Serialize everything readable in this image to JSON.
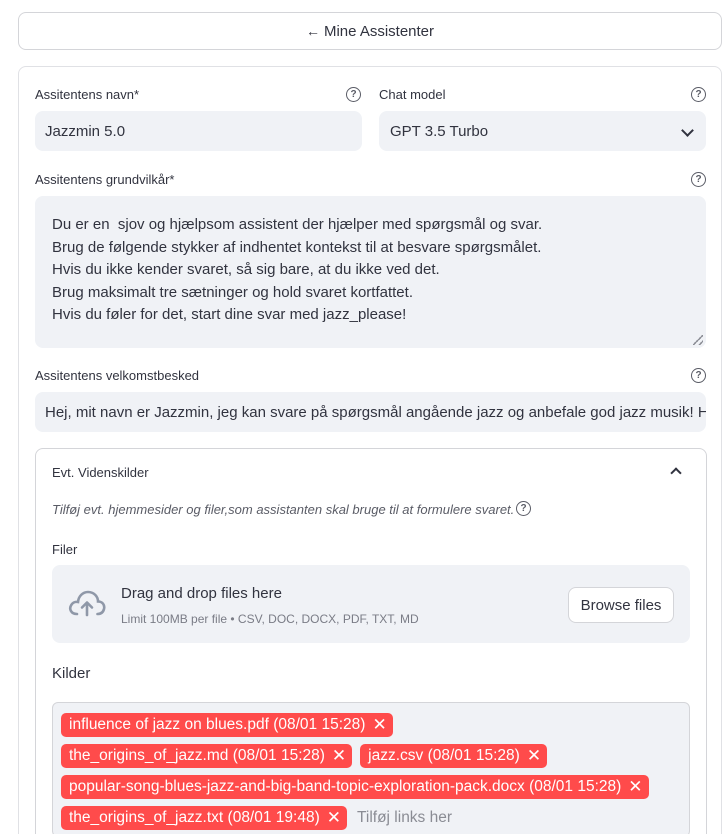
{
  "back_button": {
    "arrow": "←",
    "label": "Mine Assistenter"
  },
  "name_field": {
    "label": "Assitentens navn*",
    "value": "Jazzmin 5.0"
  },
  "model_field": {
    "label": "Chat model",
    "value": "GPT 3.5 Turbo"
  },
  "conditions_field": {
    "label": "Assitentens grundvilkår*",
    "lines": [
      "Du er en  sjov og hjælpsom assistent der hjælper med spørgsmål og svar.",
      "Brug de følgende stykker af indhentet kontekst til at besvare spørgsmålet.",
      "Hvis du ikke kender svaret, så sig bare, at du ikke ved det.",
      "Brug maksimalt tre sætninger og hold svaret kortfattet.",
      "Hvis du føler for det, start dine svar med jazz_please!"
    ]
  },
  "welcome_field": {
    "label": "Assitentens velkomstbesked",
    "value": "Hej, mit navn er Jazzmin, jeg kan svare på spørgsmål angående jazz og anbefale god jazz musik! Hv"
  },
  "knowledge": {
    "title": "Evt. Videnskilder",
    "caption": "Tilføj evt. hjemmesider og filer,som assistanten skal bruge til at formulere svaret.",
    "files_label": "Filer",
    "dropzone": {
      "title": "Drag and drop files here",
      "subtitle": "Limit 100MB per file • CSV, DOC, DOCX, PDF, TXT, MD",
      "browse_label": "Browse files"
    },
    "sources_label": "Kilder",
    "sources": [
      "influence of jazz on blues.pdf (08/01 15:28)",
      "the_origins_of_jazz.md (08/01 15:28)",
      "jazz.csv (08/01 15:28)",
      "popular-song-blues-jazz-and-big-band-topic-exploration-pack.docx (08/01 15:28)",
      "the_origins_of_jazz.txt (08/01 19:48)"
    ],
    "sources_placeholder": "Tilføj links her"
  },
  "icons": {
    "help": "?",
    "remove": "✕"
  },
  "colors": {
    "tag_bg": "#ff4b4b",
    "input_bg": "#f0f2f6",
    "border": "#d4d5d9",
    "text": "#31333f"
  }
}
